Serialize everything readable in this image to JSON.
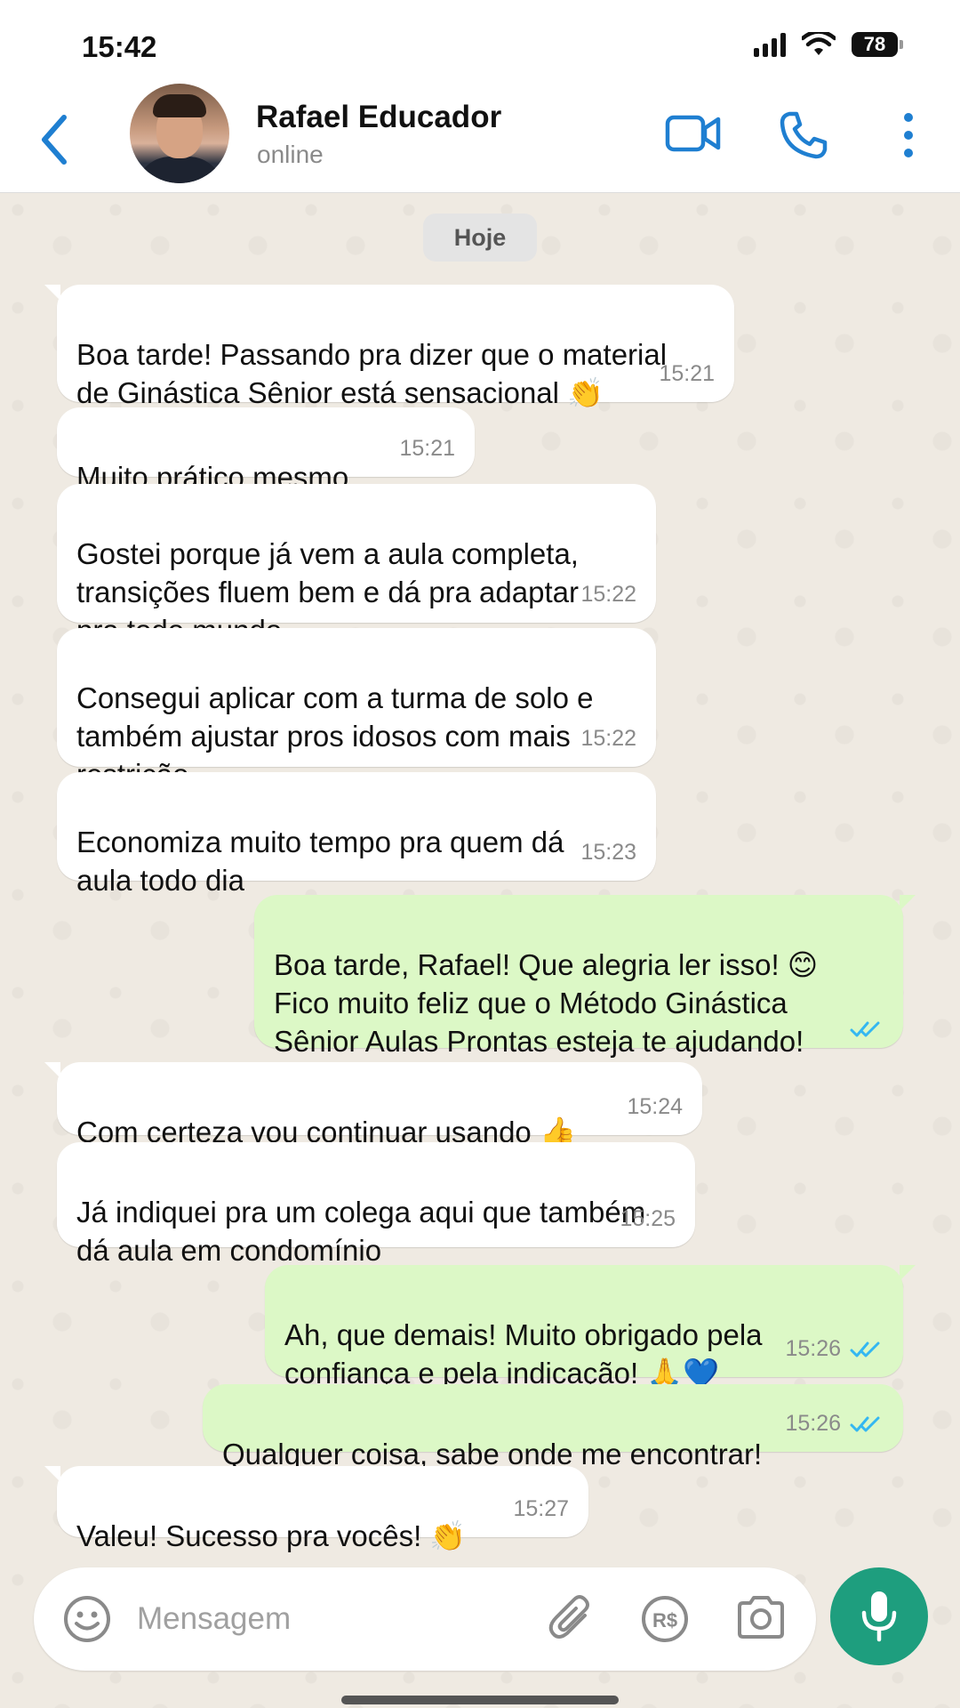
{
  "status_bar": {
    "time": "15:42",
    "battery": "78"
  },
  "header": {
    "contact_name": "Rafael Educador",
    "contact_status": "online",
    "back_icon": "chevron-left-icon",
    "video_icon": "video-camera-icon",
    "call_icon": "phone-icon",
    "menu_icon": "more-vertical-icon",
    "accent": "#1f7fd1"
  },
  "date_chip": "Hoje",
  "messages": [
    {
      "dir": "in",
      "text": "Boa tarde! Passando pra dizer que o material\nde Ginástica Sênior está sensacional 👏",
      "time": "15:21"
    },
    {
      "dir": "in",
      "text": "Muito prático mesmo",
      "time": "15:21"
    },
    {
      "dir": "in",
      "text": "Gostei porque já vem a aula completa,\ntransições fluem bem e dá pra adaptar\npra todo mundo",
      "time": "15:22"
    },
    {
      "dir": "in",
      "text": "Consegui aplicar com a turma de solo e\ntambém ajustar pros idosos com mais\nrestrição",
      "time": "15:22"
    },
    {
      "dir": "in",
      "text": "Economiza muito tempo pra quem dá\naula todo dia",
      "time": "15:23"
    },
    {
      "dir": "out",
      "text": "Boa tarde, Rafael! Que alegria ler isso! 😊\nFico muito feliz que o Método Ginástica\nSênior Aulas Prontas esteja te ajudando!",
      "time": ""
    },
    {
      "dir": "in",
      "text": "Com certeza vou continuar usando 👍",
      "time": "15:24"
    },
    {
      "dir": "in",
      "text": "Já indiquei pra um colega aqui que também\ndá aula em condomínio",
      "time": "15:25"
    },
    {
      "dir": "out",
      "text": "Ah, que demais! Muito obrigado pela\nconfiança e pela indicação! 🙏💙",
      "time": "15:26"
    },
    {
      "dir": "out",
      "text": "Qualquer coisa, sabe onde me encontrar!",
      "time": "15:26"
    },
    {
      "dir": "in",
      "text": "Valeu! Sucesso pra vocês! 👏",
      "time": "15:27"
    }
  ],
  "input": {
    "placeholder": "Mensagem",
    "emoji_icon": "emoji-icon",
    "attach_icon": "paperclip-icon",
    "payment_icon": "real-currency-icon",
    "camera_icon": "camera-icon",
    "mic_icon": "microphone-icon",
    "mic_color": "#1e9e7e"
  }
}
